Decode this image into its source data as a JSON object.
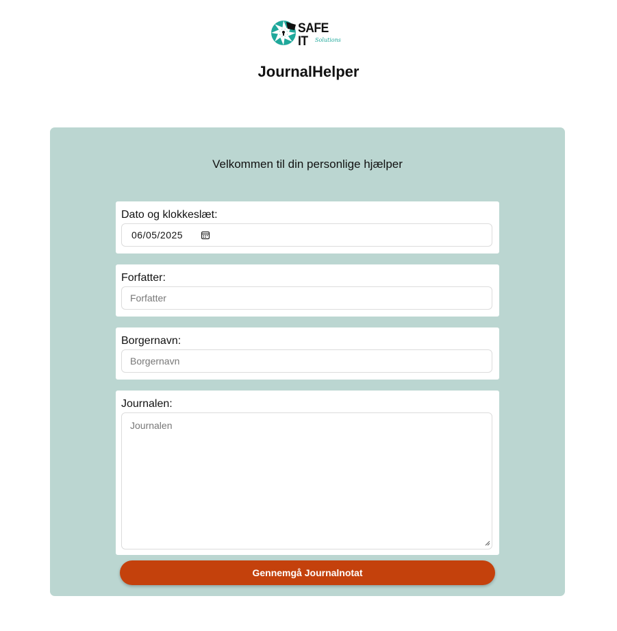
{
  "brand": {
    "logo_text": "SAFE IT",
    "logo_subtext": "Solutions",
    "accent_color": "#1fa89b"
  },
  "app": {
    "title": "JournalHelper"
  },
  "form": {
    "welcome": "Velkommen til din personlige hjælper",
    "date_field": {
      "label": "Dato og klokkeslæt:",
      "value": "06/05/2025",
      "icon": "calendar-icon"
    },
    "author_field": {
      "label": "Forfatter:",
      "placeholder": "Forfatter",
      "value": ""
    },
    "citizen_field": {
      "label": "Borgernavn:",
      "placeholder": "Borgernavn",
      "value": ""
    },
    "journal_field": {
      "label": "Journalen:",
      "placeholder": "Journalen",
      "value": ""
    },
    "submit_label": "Gennemgå Journalnotat"
  },
  "colors": {
    "panel_background": "#bbd6d1",
    "button_background": "#c4410c",
    "button_text": "#ffffff"
  }
}
